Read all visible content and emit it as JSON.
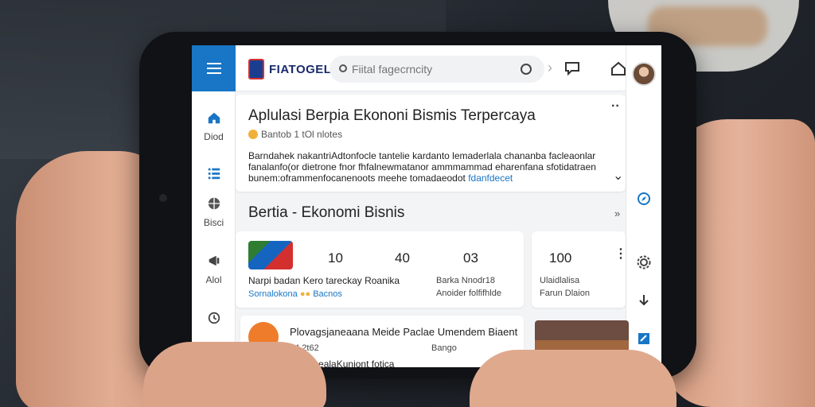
{
  "app": {
    "logo_text": "FIATOGEL",
    "search_placeholder": "Fiital fagecrncity"
  },
  "nav": {
    "items": [
      {
        "label": "Diod",
        "icon": "home-icon"
      },
      {
        "label": "",
        "icon": "list-icon"
      },
      {
        "label": "Bisci",
        "icon": "globe-icon"
      },
      {
        "label": "Alol",
        "icon": "megaphone-icon"
      },
      {
        "label": "",
        "icon": "clock-icon"
      },
      {
        "label": "",
        "icon": "person-icon"
      }
    ]
  },
  "top_icons": [
    "chat-icon",
    "home-outline-icon"
  ],
  "right_icons": [
    "compass-icon",
    "gear-icon",
    "download-icon",
    "edit-icon"
  ],
  "article": {
    "title": "Aplulasi Berpia Ekononi Bismis Terpercaya",
    "meta": "Bantob 1 tOl nlotes",
    "body_line1": "Barndahek nakantriAdtonfocle tantelie kardanto lemaderlala chananba facleaonlar",
    "body_line2": "fanalanfo(or dietrone fnor fhfalnewmatanor ammmammad eharenfana sfotidatraen",
    "body_line3": "bunem:oframmenfocanenoots meehe tomadaeodot",
    "body_link": "fdanfdecet"
  },
  "section": {
    "title": "Bertia - Ekonomi Bisnis"
  },
  "stats": {
    "values": [
      "10",
      "40",
      "03",
      "100"
    ],
    "headline": "Narpi badan Kero tareckay Roanika",
    "tag": "Sornalokona",
    "tag2": "Bacnos",
    "col2_line1": "Barka Nnodr18",
    "col2_line2": "Anoider folfifhlde",
    "col4_line1": "Ulaidlalisa",
    "col4_line2": "Farun Dlaion"
  },
  "post": {
    "title": "Plovagsjaneaana Meide Paclae Umendem Biaent",
    "meta_left": "04 2t62",
    "meta_right": "Bango",
    "footer": "Nenolmdwilo lagealaKuniont fotica"
  }
}
